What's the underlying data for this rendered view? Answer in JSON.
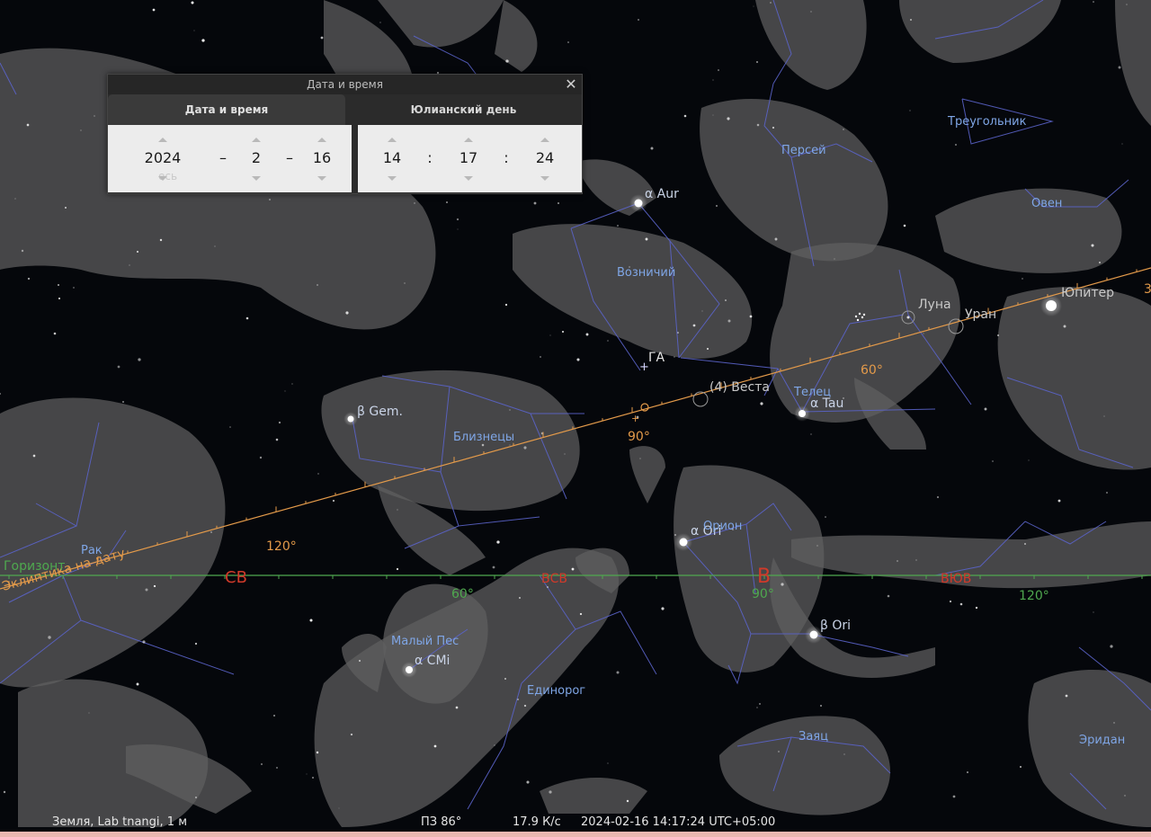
{
  "dialog": {
    "title": "Дата и время",
    "tabs": [
      {
        "label": "Дата и время"
      },
      {
        "label": "Юлианский день"
      }
    ],
    "date": {
      "year": "2024",
      "month": "2",
      "day": "16"
    },
    "time": {
      "hour": "14",
      "minute": "17",
      "second": "24"
    },
    "separators": {
      "date": "–",
      "time": ":"
    },
    "ghost_label": "есь"
  },
  "sky": {
    "constellations": [
      {
        "name": "Персей"
      },
      {
        "name": "Треугольник"
      },
      {
        "name": "Овен"
      },
      {
        "name": "Возничий"
      },
      {
        "name": "Телец"
      },
      {
        "name": "Близнецы"
      },
      {
        "name": "Рак"
      },
      {
        "name": "Орион"
      },
      {
        "name": "Малый Пес"
      },
      {
        "name": "Единорог"
      },
      {
        "name": "Заяц"
      },
      {
        "name": "Эридан"
      }
    ],
    "stars": [
      {
        "label": "α Aur"
      },
      {
        "label": "β Gem."
      },
      {
        "label": "α Tau"
      },
      {
        "label": "α Ori"
      },
      {
        "label": "β Ori"
      },
      {
        "label": "α CMi"
      }
    ],
    "objects": [
      {
        "label": "Луна"
      },
      {
        "label": "Уран"
      },
      {
        "label": "Юпитер"
      },
      {
        "label": "(4) Веста"
      },
      {
        "label": "ГА"
      }
    ],
    "ecliptic": {
      "label": "Эклиптика на дату",
      "degrees": [
        "120°",
        "90°",
        "60°"
      ],
      "edge_mark": "3",
      "color": "#e39a4a"
    },
    "horizon": {
      "label": "Горизонт",
      "directions": [
        "СВ",
        "ВСВ",
        "В",
        "ВЮВ"
      ],
      "degrees": [
        "60°",
        "90°",
        "120°"
      ],
      "color": "#4fa84f",
      "direction_color": "#d03a2a"
    }
  },
  "status": {
    "location": "Земля, Lab  tnangi, 1 м",
    "fov": "ПЗ 86°",
    "fps": "17.9 К/с",
    "datetime": "2024-02-16 14:17:24 UTC+05:00"
  }
}
